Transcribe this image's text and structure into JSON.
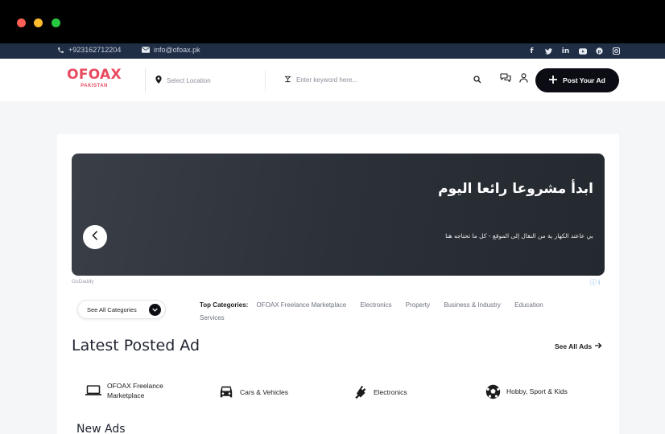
{
  "window": {
    "controls": [
      "close",
      "minimize",
      "maximize"
    ]
  },
  "topbar": {
    "phone": "+923162712204",
    "email": "info@ofoax.pk",
    "socials": [
      "facebook-icon",
      "twitter-icon",
      "linkedin-icon",
      "youtube-icon",
      "pinterest-icon",
      "instagram-icon"
    ]
  },
  "header": {
    "logo_main": "OFOAX",
    "logo_sub": "PAKISTAN",
    "location_placeholder": "Select Location",
    "keyword_placeholder": "Enter keyword here...",
    "post_ad_label": "Post Your Ad"
  },
  "banner": {
    "title": "ابدأ مشروعا رائعا اليوم",
    "subtitle": "بي عاعتد الكهار ية من النقال إلى الموقع - كل ما تحتاجه هنا",
    "advertiser": "GoDaddy",
    "ad_info": "ⓘ i"
  },
  "categories": {
    "see_all_label": "See All Categories",
    "top_label": "Top Categories:",
    "top": [
      "OFOAX Freelance Marketplace",
      "Electronics",
      "Property",
      "Business & Industry",
      "Education",
      "Services"
    ]
  },
  "latest": {
    "title": "Latest Posted Ad",
    "see_all": "See All Ads",
    "quick_categories": [
      {
        "label_line1": "OFOAX Freelance",
        "label_line2": "Marketplace",
        "icon": "laptop-icon"
      },
      {
        "label_line1": "Cars & Vehicles",
        "label_line2": "",
        "icon": "car-icon"
      },
      {
        "label_line1": "Electronics",
        "label_line2": "",
        "icon": "plug-icon"
      },
      {
        "label_line1": "Hobby, Sport & Kids",
        "label_line2": "",
        "icon": "football-icon"
      }
    ]
  },
  "new_ads": {
    "title": "New Ads"
  },
  "colors": {
    "brand": "#e84a5f",
    "topbar": "#1f2d45",
    "dark_button": "#0c0c14"
  }
}
